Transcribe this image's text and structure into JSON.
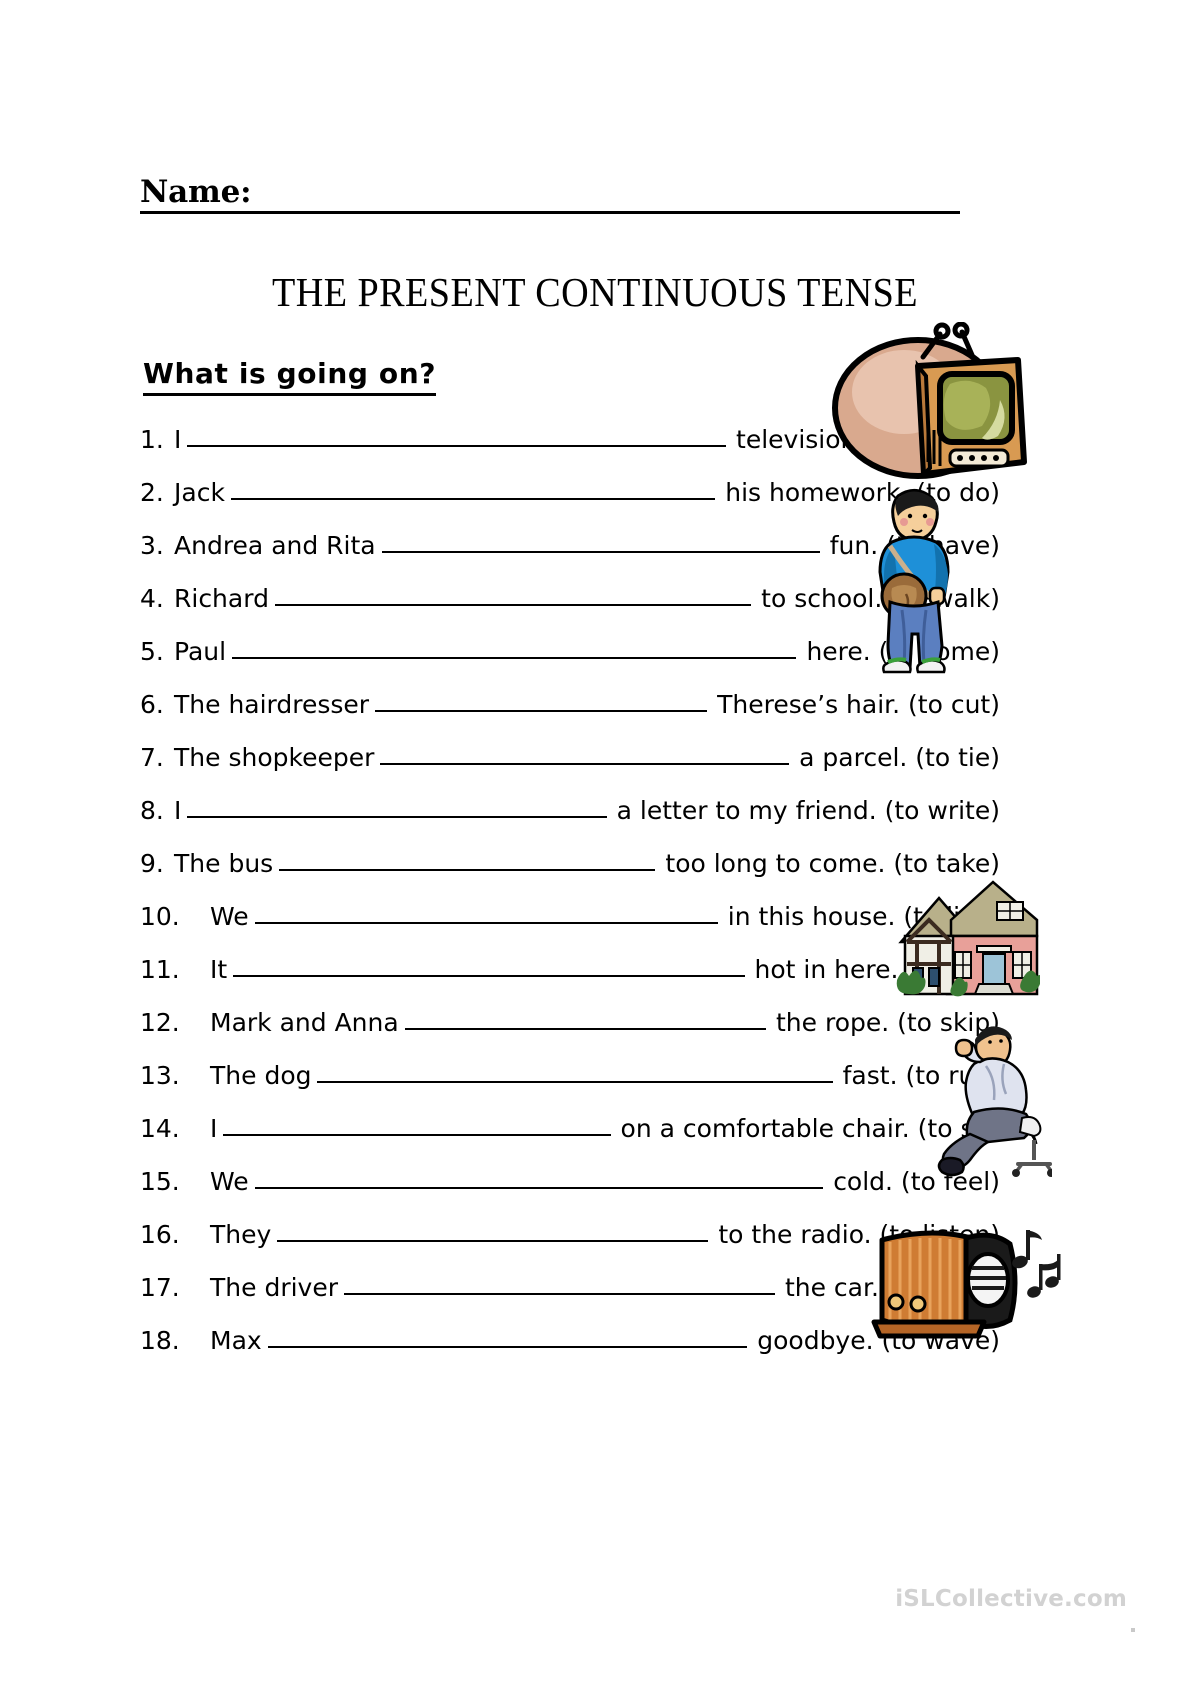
{
  "header": {
    "name_label": "Name:",
    "title": "THE PRESENT CONTINUOUS TENSE",
    "section_heading": "What is going on?"
  },
  "exercises": [
    {
      "num": "1.",
      "subject": "I",
      "tail": "television. (to watch)"
    },
    {
      "num": "2.",
      "subject": "Jack",
      "tail": "his homework. (to do)"
    },
    {
      "num": "3.",
      "subject": "Andrea and Rita",
      "tail": "fun. (to have)"
    },
    {
      "num": "4.",
      "subject": "Richard",
      "tail": "to school. (to walk)"
    },
    {
      "num": "5.",
      "subject": "Paul",
      "tail": "here. (to come)"
    },
    {
      "num": "6.",
      "subject": "The hairdresser",
      "tail": "Therese’s hair. (to cut)"
    },
    {
      "num": "7.",
      "subject": "The shopkeeper",
      "tail": "a parcel. (to tie)"
    },
    {
      "num": "8.",
      "subject": "I",
      "tail": "a letter to my friend. (to write)"
    },
    {
      "num": "9.",
      "subject": "The bus",
      "tail": "too long to come. (to take)"
    },
    {
      "num": "10.",
      "subject": "We",
      "tail": "in this house. (to live)"
    },
    {
      "num": "11.",
      "subject": "It",
      "tail": "hot in here. (to get)"
    },
    {
      "num": "12.",
      "subject": "Mark and Anna",
      "tail": "the rope. (to skip)"
    },
    {
      "num": "13.",
      "subject": "The dog",
      "tail": "fast. (to run)"
    },
    {
      "num": "14.",
      "subject": "I",
      "tail": "on a comfortable chair. (to sit)"
    },
    {
      "num": "15.",
      "subject": "We",
      "tail": "cold. (to feel)"
    },
    {
      "num": "16.",
      "subject": "They",
      "tail": "to the radio. (to listen)"
    },
    {
      "num": "17.",
      "subject": "The driver",
      "tail": "the car. (to push)"
    },
    {
      "num": "18.",
      "subject": "Max",
      "tail": "goodbye. (to wave)"
    }
  ],
  "clipart": [
    {
      "name": "television-illustration",
      "alt": "Retro television set with antennas"
    },
    {
      "name": "boy-with-bag-illustration",
      "alt": "Boy in blue shirt carrying a satchel"
    },
    {
      "name": "house-illustration",
      "alt": "Tudor style house"
    },
    {
      "name": "man-on-office-chair-illustration",
      "alt": "Man sitting on an office chair"
    },
    {
      "name": "radio-illustration",
      "alt": "Radio with music notes"
    }
  ],
  "footer": {
    "watermark": "iSLCollective.com"
  },
  "colors": {
    "ink": "#000000",
    "watermark": "#d2d2d2",
    "tv_body": "#d89a52",
    "tv_screen": "#8a9440",
    "tv_blob": "#d9a98e",
    "shirt_blue": "#1e90d8",
    "jeans_blue": "#5b7fc0",
    "bag_brown": "#9a6b3a",
    "skin": "#f5cf9b",
    "house_pink": "#e8a099",
    "house_roof": "#b8b08a",
    "suit_grey": "#6f7487",
    "radio_orange": "#cf7c33"
  }
}
